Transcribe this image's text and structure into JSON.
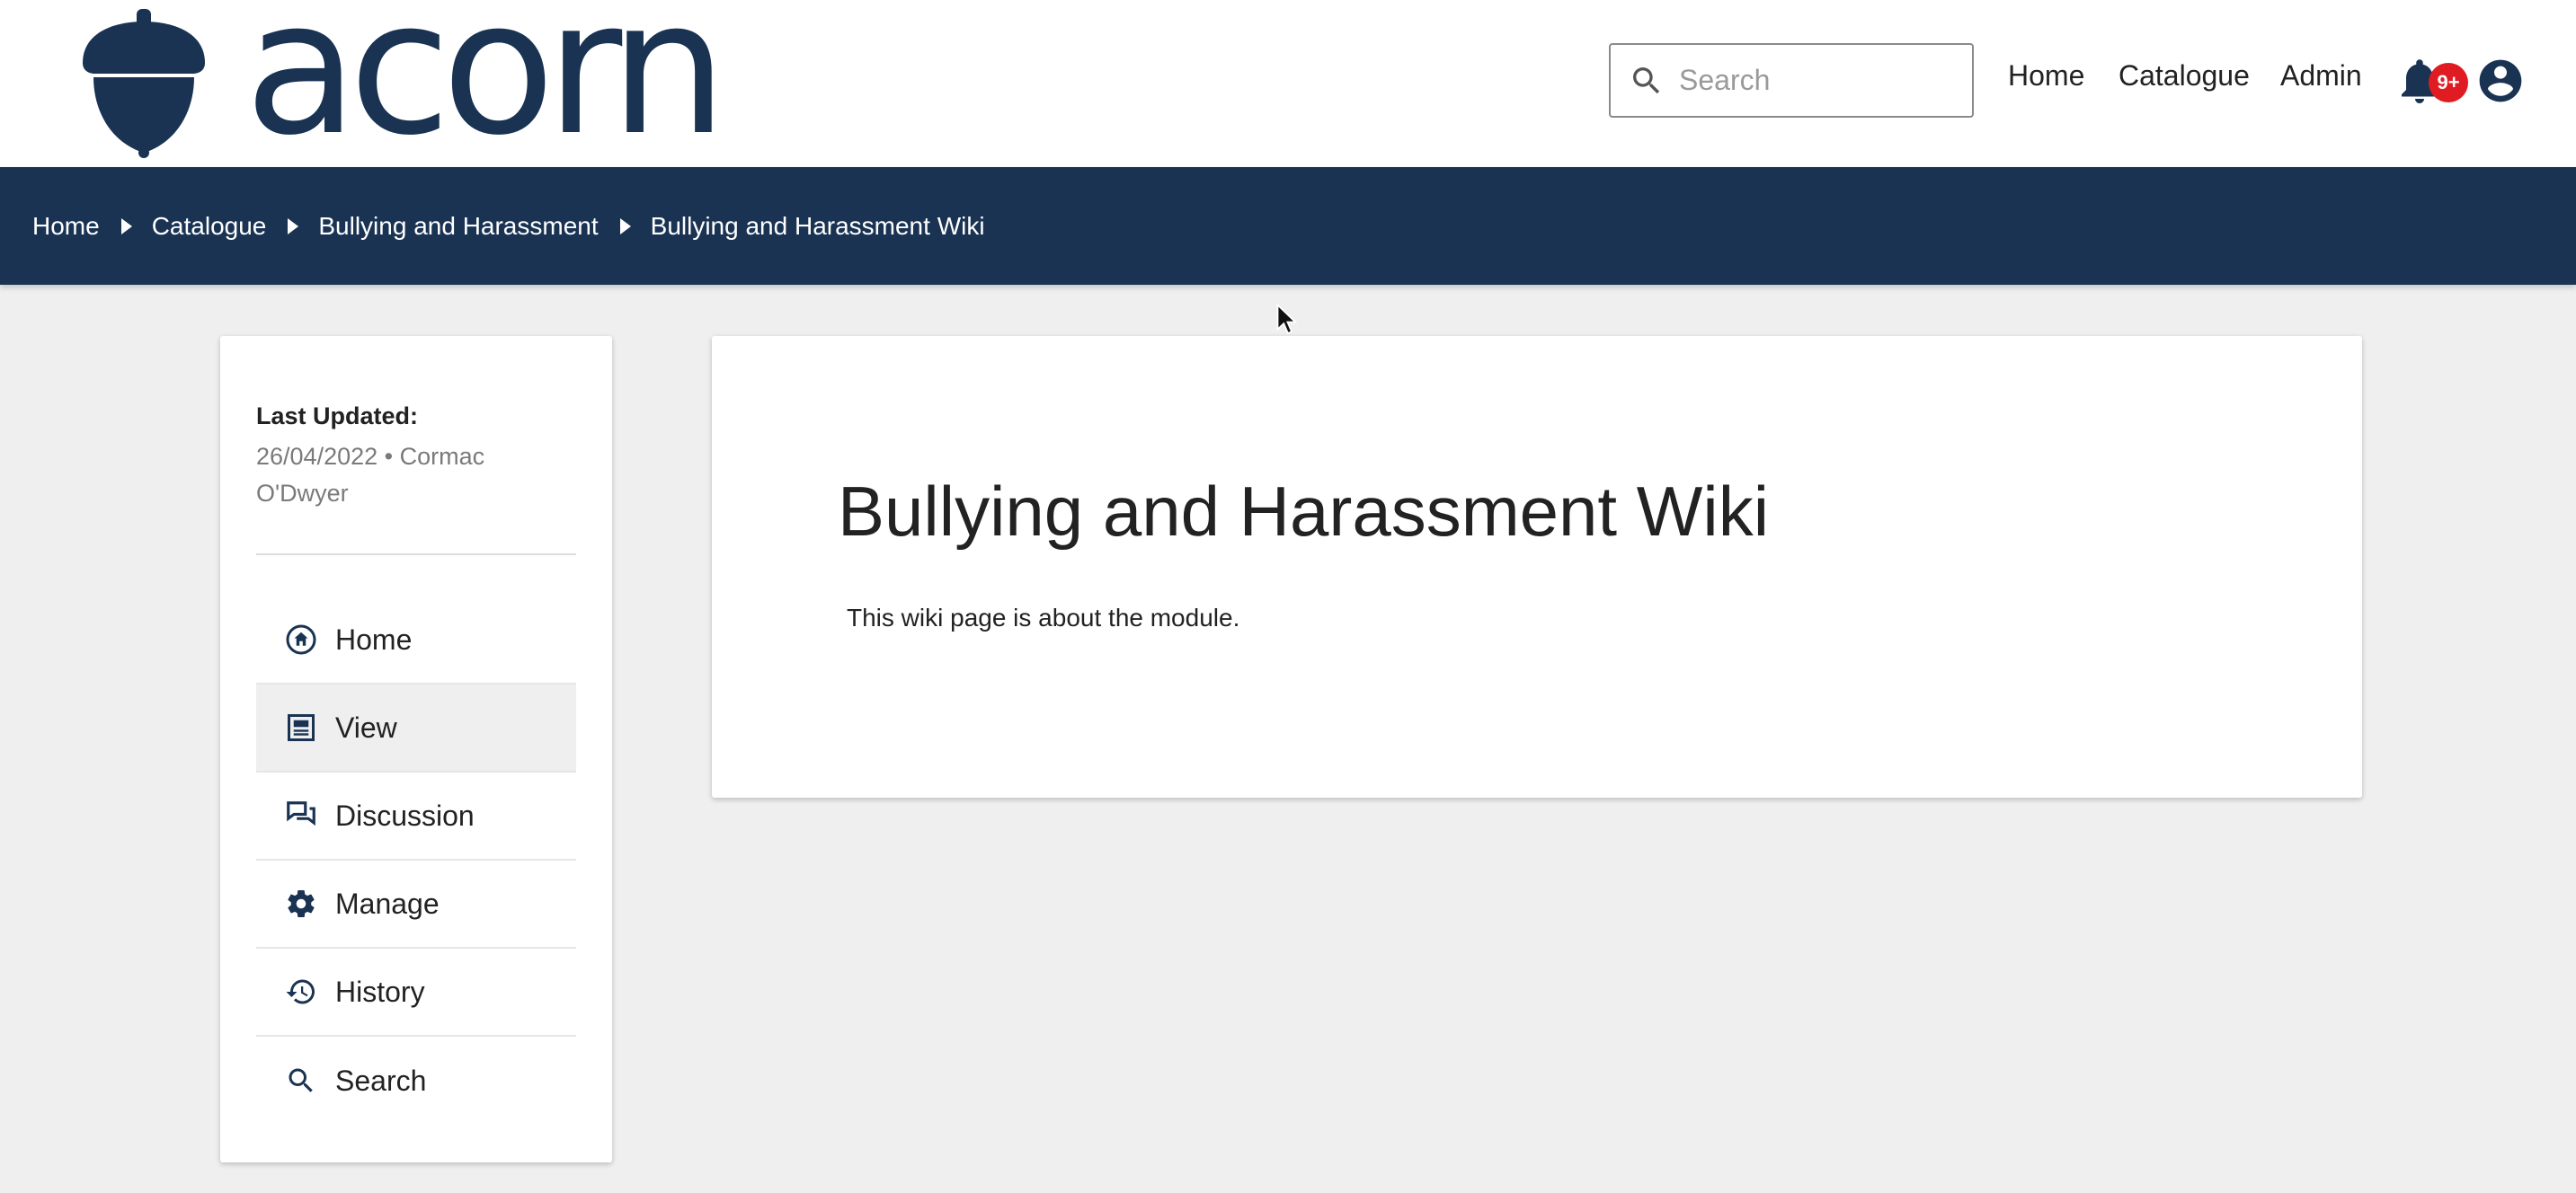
{
  "header": {
    "logo_text": "acorn",
    "search_placeholder": "Search",
    "nav": [
      {
        "label": "Home"
      },
      {
        "label": "Catalogue"
      },
      {
        "label": "Admin"
      }
    ],
    "notification_badge": "9+"
  },
  "breadcrumb": [
    {
      "label": "Home"
    },
    {
      "label": "Catalogue"
    },
    {
      "label": "Bullying and Harassment"
    },
    {
      "label": "Bullying and Harassment Wiki"
    }
  ],
  "sidebar": {
    "last_updated_label": "Last Updated:",
    "last_updated_value": "26/04/2022 • Cormac O'Dwyer",
    "items": [
      {
        "label": "Home",
        "icon": "home-circle-icon"
      },
      {
        "label": "View",
        "icon": "view-page-icon",
        "active": true
      },
      {
        "label": "Discussion",
        "icon": "discussion-icon"
      },
      {
        "label": "Manage",
        "icon": "gear-icon"
      },
      {
        "label": "History",
        "icon": "history-icon"
      },
      {
        "label": "Search",
        "icon": "search-icon"
      }
    ]
  },
  "content": {
    "title": "Bullying and Harassment Wiki",
    "body": "This wiki page is about the module."
  },
  "colors": {
    "brand": "#1a3353",
    "badge": "#e01b22",
    "background": "#efefef"
  }
}
